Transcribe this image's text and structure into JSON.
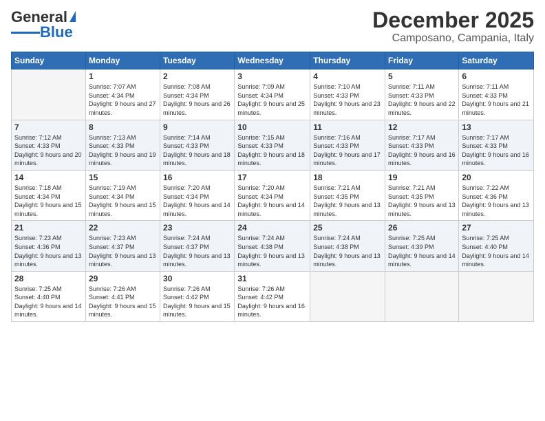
{
  "header": {
    "logo_general": "General",
    "logo_blue": "Blue",
    "month_title": "December 2025",
    "location": "Camposano, Campania, Italy"
  },
  "weekdays": [
    "Sunday",
    "Monday",
    "Tuesday",
    "Wednesday",
    "Thursday",
    "Friday",
    "Saturday"
  ],
  "rows": [
    [
      {
        "day": "",
        "empty": true
      },
      {
        "day": "1",
        "sunrise": "7:07 AM",
        "sunset": "4:34 PM",
        "daylight": "9 hours and 27 minutes."
      },
      {
        "day": "2",
        "sunrise": "7:08 AM",
        "sunset": "4:34 PM",
        "daylight": "9 hours and 26 minutes."
      },
      {
        "day": "3",
        "sunrise": "7:09 AM",
        "sunset": "4:34 PM",
        "daylight": "9 hours and 25 minutes."
      },
      {
        "day": "4",
        "sunrise": "7:10 AM",
        "sunset": "4:33 PM",
        "daylight": "9 hours and 23 minutes."
      },
      {
        "day": "5",
        "sunrise": "7:11 AM",
        "sunset": "4:33 PM",
        "daylight": "9 hours and 22 minutes."
      },
      {
        "day": "6",
        "sunrise": "7:11 AM",
        "sunset": "4:33 PM",
        "daylight": "9 hours and 21 minutes."
      }
    ],
    [
      {
        "day": "7",
        "sunrise": "7:12 AM",
        "sunset": "4:33 PM",
        "daylight": "9 hours and 20 minutes."
      },
      {
        "day": "8",
        "sunrise": "7:13 AM",
        "sunset": "4:33 PM",
        "daylight": "9 hours and 19 minutes."
      },
      {
        "day": "9",
        "sunrise": "7:14 AM",
        "sunset": "4:33 PM",
        "daylight": "9 hours and 18 minutes."
      },
      {
        "day": "10",
        "sunrise": "7:15 AM",
        "sunset": "4:33 PM",
        "daylight": "9 hours and 18 minutes."
      },
      {
        "day": "11",
        "sunrise": "7:16 AM",
        "sunset": "4:33 PM",
        "daylight": "9 hours and 17 minutes."
      },
      {
        "day": "12",
        "sunrise": "7:17 AM",
        "sunset": "4:33 PM",
        "daylight": "9 hours and 16 minutes."
      },
      {
        "day": "13",
        "sunrise": "7:17 AM",
        "sunset": "4:33 PM",
        "daylight": "9 hours and 16 minutes."
      }
    ],
    [
      {
        "day": "14",
        "sunrise": "7:18 AM",
        "sunset": "4:34 PM",
        "daylight": "9 hours and 15 minutes."
      },
      {
        "day": "15",
        "sunrise": "7:19 AM",
        "sunset": "4:34 PM",
        "daylight": "9 hours and 15 minutes."
      },
      {
        "day": "16",
        "sunrise": "7:20 AM",
        "sunset": "4:34 PM",
        "daylight": "9 hours and 14 minutes."
      },
      {
        "day": "17",
        "sunrise": "7:20 AM",
        "sunset": "4:34 PM",
        "daylight": "9 hours and 14 minutes."
      },
      {
        "day": "18",
        "sunrise": "7:21 AM",
        "sunset": "4:35 PM",
        "daylight": "9 hours and 13 minutes."
      },
      {
        "day": "19",
        "sunrise": "7:21 AM",
        "sunset": "4:35 PM",
        "daylight": "9 hours and 13 minutes."
      },
      {
        "day": "20",
        "sunrise": "7:22 AM",
        "sunset": "4:36 PM",
        "daylight": "9 hours and 13 minutes."
      }
    ],
    [
      {
        "day": "21",
        "sunrise": "7:23 AM",
        "sunset": "4:36 PM",
        "daylight": "9 hours and 13 minutes."
      },
      {
        "day": "22",
        "sunrise": "7:23 AM",
        "sunset": "4:37 PM",
        "daylight": "9 hours and 13 minutes."
      },
      {
        "day": "23",
        "sunrise": "7:24 AM",
        "sunset": "4:37 PM",
        "daylight": "9 hours and 13 minutes."
      },
      {
        "day": "24",
        "sunrise": "7:24 AM",
        "sunset": "4:38 PM",
        "daylight": "9 hours and 13 minutes."
      },
      {
        "day": "25",
        "sunrise": "7:24 AM",
        "sunset": "4:38 PM",
        "daylight": "9 hours and 13 minutes."
      },
      {
        "day": "26",
        "sunrise": "7:25 AM",
        "sunset": "4:39 PM",
        "daylight": "9 hours and 14 minutes."
      },
      {
        "day": "27",
        "sunrise": "7:25 AM",
        "sunset": "4:40 PM",
        "daylight": "9 hours and 14 minutes."
      }
    ],
    [
      {
        "day": "28",
        "sunrise": "7:25 AM",
        "sunset": "4:40 PM",
        "daylight": "9 hours and 14 minutes."
      },
      {
        "day": "29",
        "sunrise": "7:26 AM",
        "sunset": "4:41 PM",
        "daylight": "9 hours and 15 minutes."
      },
      {
        "day": "30",
        "sunrise": "7:26 AM",
        "sunset": "4:42 PM",
        "daylight": "9 hours and 15 minutes."
      },
      {
        "day": "31",
        "sunrise": "7:26 AM",
        "sunset": "4:42 PM",
        "daylight": "9 hours and 16 minutes."
      },
      {
        "day": "",
        "empty": true
      },
      {
        "day": "",
        "empty": true
      },
      {
        "day": "",
        "empty": true
      }
    ]
  ]
}
